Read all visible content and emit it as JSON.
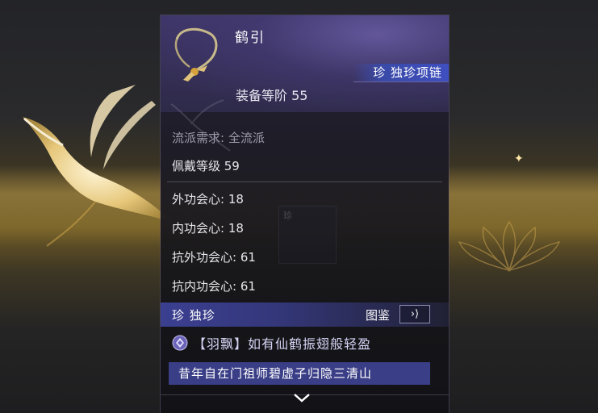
{
  "item": {
    "name": "鹤引",
    "rarity_label": "珍 独珍项链",
    "gear_level": "装备等阶 55",
    "school_requirement": "流派需求: 全流派",
    "wear_level": "佩戴等级 59"
  },
  "stats": [
    {
      "label": "外功会心: 18"
    },
    {
      "label": "内功会心: 18"
    },
    {
      "label": "抗外功会心: 61"
    },
    {
      "label": "抗内功会心: 61"
    }
  ],
  "unique_section": {
    "label": "珍 独珍",
    "collection_label": "图鉴",
    "collection_button_glyph": "›⟩",
    "effect_text": "【羽飘】如有仙鹤振翅般轻盈",
    "lore_text": "昔年自在门祖师碧虚子归隐三清山"
  },
  "background": {
    "watermark": "珍"
  },
  "colors": {
    "panel_bg": "#1e1d26",
    "header_bg": "#3e3668",
    "accent_blue": "#3a4aa8",
    "unique_bar": "#3b3f90",
    "lore_bg": "#3a3e86",
    "text_muted": "#9d9bab",
    "text_main": "#e6e6ea",
    "gold": "#c9a24a"
  },
  "icons": {
    "item": "necklace-icon",
    "effect": "gem-icon",
    "scroll": "chevron-down-icon",
    "crane": "crane-icon"
  }
}
